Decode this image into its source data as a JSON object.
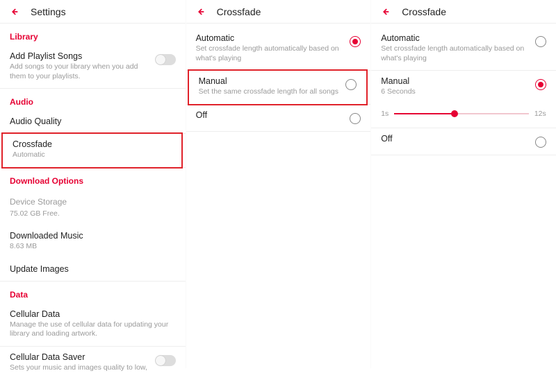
{
  "accent": "#e60033",
  "panel1": {
    "title": "Settings",
    "library": {
      "heading": "Library"
    },
    "addPlaylist": {
      "label": "Add Playlist Songs",
      "sub": "Add songs to your library when you add them to your playlists."
    },
    "audio": {
      "heading": "Audio"
    },
    "audioQuality": {
      "label": "Audio Quality"
    },
    "crossfade": {
      "label": "Crossfade",
      "sub": "Automatic"
    },
    "downloadOptions": {
      "heading": "Download Options"
    },
    "deviceStorage": {
      "label": "Device Storage",
      "sub": "75.02 GB Free."
    },
    "downloadedMusic": {
      "label": "Downloaded Music",
      "sub": "8.63 MB"
    },
    "updateImages": {
      "label": "Update Images"
    },
    "data": {
      "heading": "Data"
    },
    "cellularData": {
      "label": "Cellular Data",
      "sub": "Manage the use of cellular data for updating your library and loading artwork."
    },
    "cellularDataSaver": {
      "label": "Cellular Data Saver",
      "sub": "Sets your music and images quality to low,"
    }
  },
  "panel2": {
    "title": "Crossfade",
    "automatic": {
      "label": "Automatic",
      "sub": "Set crossfade length automatically based on what's playing"
    },
    "manual": {
      "label": "Manual",
      "sub": "Set the same crossfade length for all songs"
    },
    "off": {
      "label": "Off"
    }
  },
  "panel3": {
    "title": "Crossfade",
    "automatic": {
      "label": "Automatic",
      "sub": "Set crossfade length automatically based on what's playing"
    },
    "manual": {
      "label": "Manual",
      "sub": "6 Seconds"
    },
    "slider": {
      "min": "1s",
      "max": "12s",
      "valuePercent": 45
    },
    "off": {
      "label": "Off"
    }
  }
}
